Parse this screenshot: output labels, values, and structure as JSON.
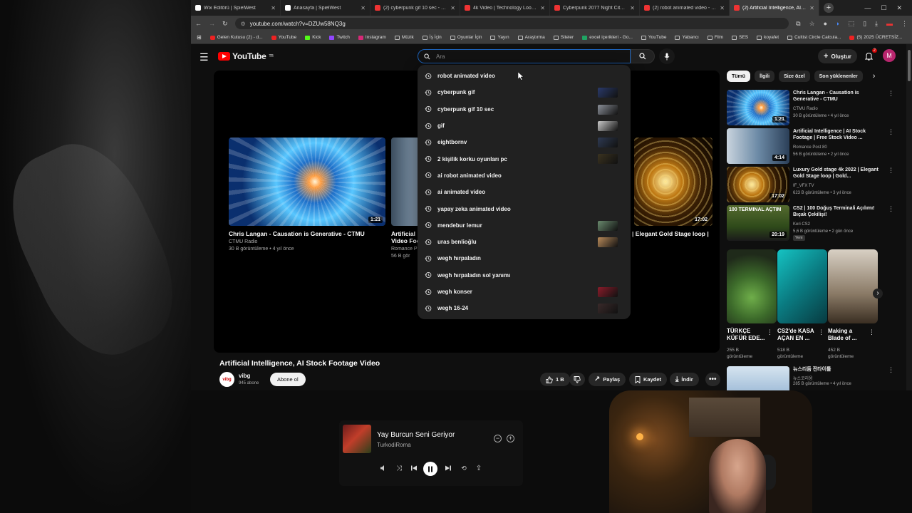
{
  "browser": {
    "tabs": [
      {
        "title": "Wix Editörü | SpielWest",
        "favicon": "wix-icon"
      },
      {
        "title": "Anasayfa | SpielWest",
        "favicon": "site-icon"
      },
      {
        "title": "(2) cyberpunk gif 10 sec - YouT",
        "favicon": "youtube-icon"
      },
      {
        "title": "4k Video | Technology Looped",
        "favicon": "youtube-icon"
      },
      {
        "title": "Cyberpunk 2077 Night City live",
        "favicon": "youtube-icon"
      },
      {
        "title": "(2) robot animated video - You",
        "favicon": "youtube-icon"
      },
      {
        "title": "(2) Artificial Intelligence, AI Sto",
        "favicon": "youtube-icon",
        "active": true
      }
    ],
    "url": "youtube.com/watch?v=DZUw58NQ3g",
    "bookmarks": [
      "Gelen Kutusu (2) - d...",
      "YouTube",
      "Kick",
      "Twitch",
      "Instagram",
      "Müzik",
      "İş İçin",
      "Oyunlar İçin",
      "Yayın",
      "Araştırma",
      "Siteler",
      "excel içerikleri - Go...",
      "YouTube",
      "Yabancı",
      "Film",
      "SES",
      "koyafet",
      "Cultist Circle Calcula...",
      "(5) 2025 ÜCRETSİZ..."
    ]
  },
  "youtube": {
    "logo_text": "YouTube",
    "logo_region": "TR",
    "search_placeholder": "Ara",
    "create_label": "Oluştur",
    "notification_count": "2",
    "avatar_letter": "M"
  },
  "suggestions": [
    {
      "text": "robot animated video",
      "thumb": false
    },
    {
      "text": "cyberpunk gif",
      "thumb": true,
      "color": "#2a3a6a"
    },
    {
      "text": "cyberpunk gif 10 sec",
      "thumb": true,
      "color": "#8a8f98"
    },
    {
      "text": "gif",
      "thumb": true,
      "color": "#c9c9c9"
    },
    {
      "text": "eightbornv",
      "thumb": true,
      "color": "#2e3a52"
    },
    {
      "text": "2 kişilik korku oyunları pc",
      "thumb": true,
      "color": "#3b3320"
    },
    {
      "text": "ai robot animated video",
      "thumb": false
    },
    {
      "text": "ai animated video",
      "thumb": false
    },
    {
      "text": "yapay zeka animated video",
      "thumb": false
    },
    {
      "text": "mendebur lemur",
      "thumb": true,
      "color": "#6a8a6e"
    },
    {
      "text": "uras benlioğlu",
      "thumb": true,
      "color": "#b88a5a"
    },
    {
      "text": "wegh hırpaladın",
      "thumb": false
    },
    {
      "text": "wegh hırpaladın sol yanımı",
      "thumb": false
    },
    {
      "text": "wegh konser",
      "thumb": true,
      "color": "#8a1c2a"
    },
    {
      "text": "wegh 16-24",
      "thumb": true,
      "color": "#3a2a2a"
    }
  ],
  "player_previews": [
    {
      "title": "Chris Langan - Causation is Generative - CTMU",
      "channel": "CTMU Radio",
      "meta": "30 B görüntüleme • 4 yıl önce",
      "duration": "1:21"
    },
    {
      "title": "Artificial",
      "title2": "Video Foo",
      "channel": "Romance P",
      "meta": "56 B gör"
    },
    {
      "title": "| Elegant Gold Stage loop |",
      "duration": "17:02"
    }
  ],
  "video": {
    "title": "Artificial Intelligence, AI Stock Footage Video",
    "channel": "vibg",
    "channel_avatar_text": "vibg",
    "subscribers": "945 abone",
    "subscribe_label": "Abone ol",
    "likes": "1 B",
    "share_label": "Paylaş",
    "save_label": "Kaydet",
    "download_label": "İndir"
  },
  "chips": [
    "Tümü",
    "İlgili",
    "Size özel",
    "Son yüklenenler"
  ],
  "recommendations": [
    {
      "title": "Chris Langan - Causation is Generative - CTMU",
      "channel": "CTMU Radio",
      "meta": "30 B görüntüleme • 4 yıl önce",
      "duration": "1:21"
    },
    {
      "title": "Artificial Intelligence | AI Stock Footage | Free Stock Video ...",
      "channel": "Romance Post 80",
      "meta": "56 B görüntüleme • 2 yıl önce",
      "duration": "4:14"
    },
    {
      "title": "Luxury Gold stage 4k 2022 | Elegant Gold Stage loop | Gold...",
      "channel": "IF_VFX TV",
      "meta": "623 B görüntüleme • 3 yıl önce",
      "duration": "17:02"
    },
    {
      "title": "CS2 | 100 Doğuş Terminali Açılımı! Bıçak Çekilişi!",
      "channel": "Keri CS2",
      "meta": "5,6 B görüntüleme • 2 gün önce",
      "duration": "20:19",
      "badge": "Yeni",
      "thumb_text": "100 TERMINAL AÇTIM"
    }
  ],
  "shorts": [
    {
      "title": "TÜRKÇE KÜFÜR EDE...",
      "views": "255 B",
      "views2": "görüntüleme"
    },
    {
      "title": "CS2'de KASA AÇAN EN ...",
      "views": "518 B",
      "views2": "görüntüleme"
    },
    {
      "title": "Making a Blade of ...",
      "views": "452 B",
      "views2": "görüntüleme"
    }
  ],
  "rec_last": {
    "title": "뉴스리듬 전타이틀",
    "channel": "뉴스코리웅",
    "meta": "285 B görüntüleme • 4 yıl önce"
  },
  "music": {
    "song": "Yay Burcun Seni Geriyor",
    "artist": "TurkodiRoma"
  }
}
